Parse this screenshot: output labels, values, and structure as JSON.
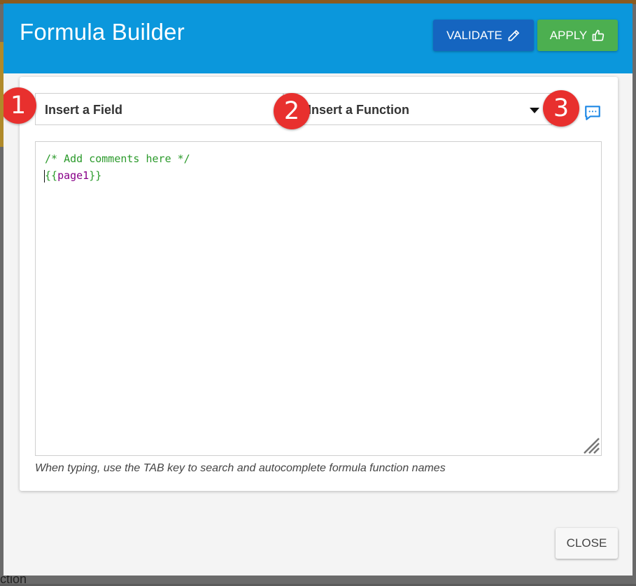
{
  "dialog": {
    "title": "Formula Builder",
    "validate_label": "VALIDATE",
    "apply_label": "APPLY",
    "close_label": "CLOSE"
  },
  "toolbar": {
    "field_select": {
      "selected": "Insert a Field"
    },
    "function_select": {
      "selected": "Insert a Function"
    },
    "badges": [
      "1",
      "2",
      "3"
    ],
    "comment_icon": "comment-icon"
  },
  "editor": {
    "line1": "/* Add comments here */",
    "line2_open": "{{",
    "line2_var": "page1",
    "line2_close": "}}"
  },
  "hint": "When typing, use the TAB key to search and autocomplete formula function names",
  "background": {
    "partial_text": "ction"
  },
  "colors": {
    "header": "#0b97dc",
    "validate": "#1565c0",
    "apply": "#4caf50",
    "badge": "#e8302e"
  }
}
